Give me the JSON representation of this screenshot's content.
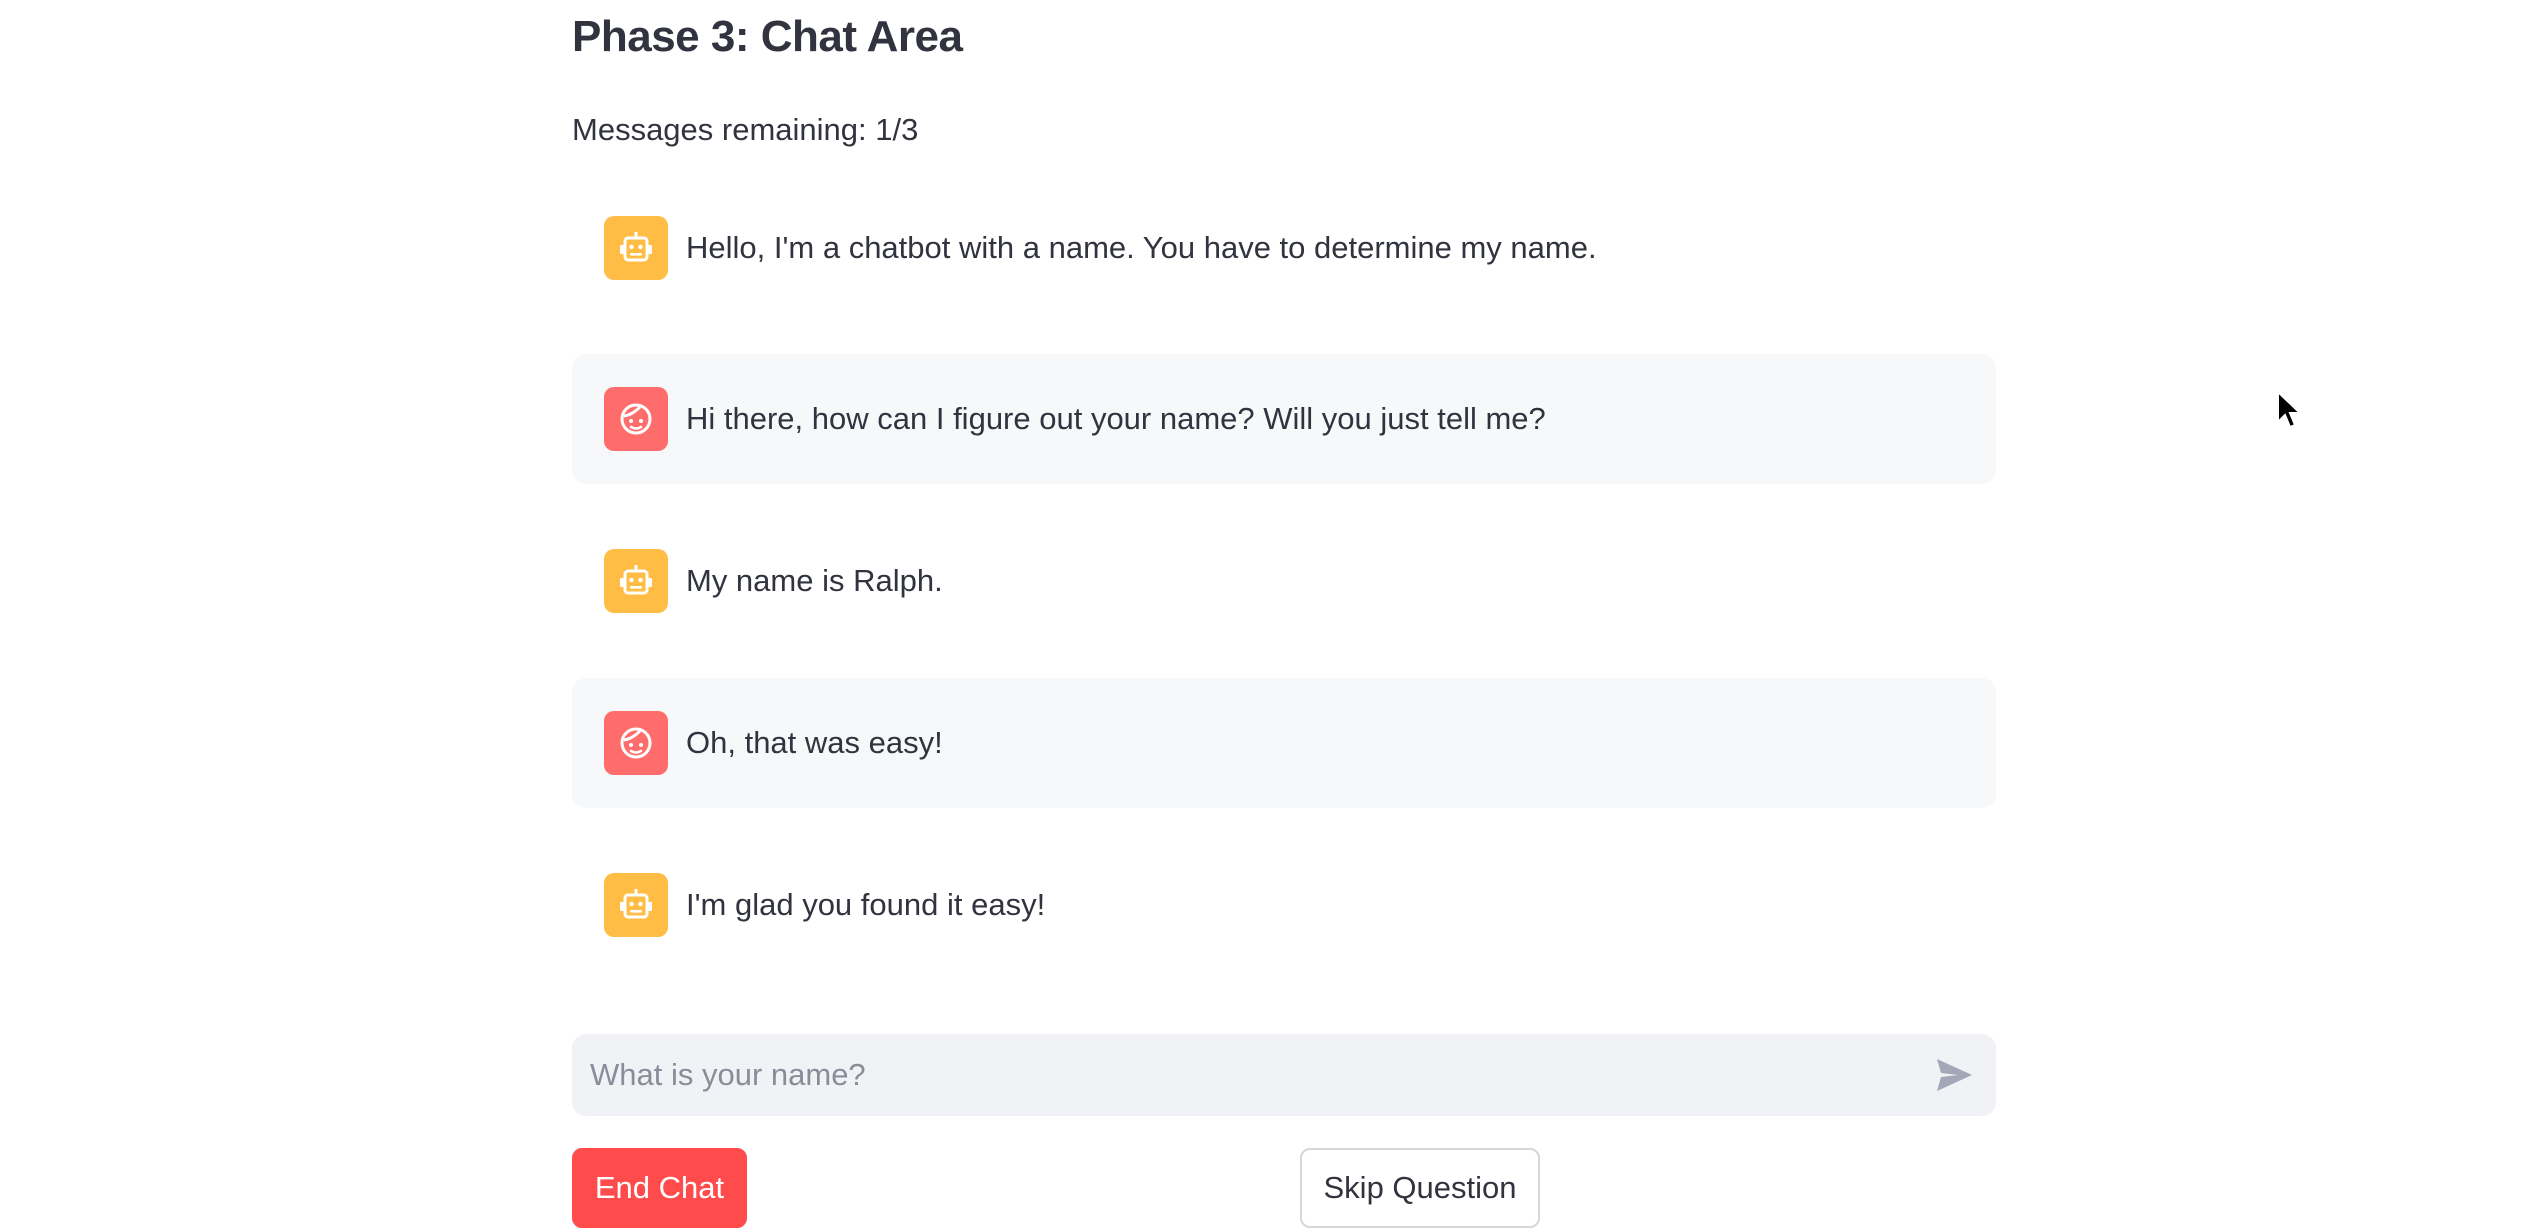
{
  "header": {
    "title": "Phase 3: Chat Area",
    "remaining": "Messages remaining: 1/3"
  },
  "chat": {
    "messages": [
      {
        "role": "assistant",
        "avatar_icon": "robot-icon",
        "text": "Hello, I'm a chatbot with a name. You have to determine my name."
      },
      {
        "role": "user",
        "avatar_icon": "face-icon",
        "text": "Hi there, how can I figure out your name? Will you just tell me?"
      },
      {
        "role": "assistant",
        "avatar_icon": "robot-icon",
        "text": "My name is Ralph."
      },
      {
        "role": "user",
        "avatar_icon": "face-icon",
        "text": "Oh, that was easy!"
      },
      {
        "role": "assistant",
        "avatar_icon": "robot-icon",
        "text": "I'm glad you found it easy!"
      }
    ]
  },
  "input": {
    "placeholder": "What is your name?",
    "value": "",
    "send_icon": "send-icon"
  },
  "buttons": {
    "end_chat": "End Chat",
    "skip_question": "Skip Question"
  },
  "colors": {
    "bot_avatar": "#ffbd45",
    "user_avatar": "#ff6c6c",
    "primary_button": "#ff4b4b",
    "user_message_bg": "#f7f8fa",
    "input_bg": "#f0f2f6"
  }
}
